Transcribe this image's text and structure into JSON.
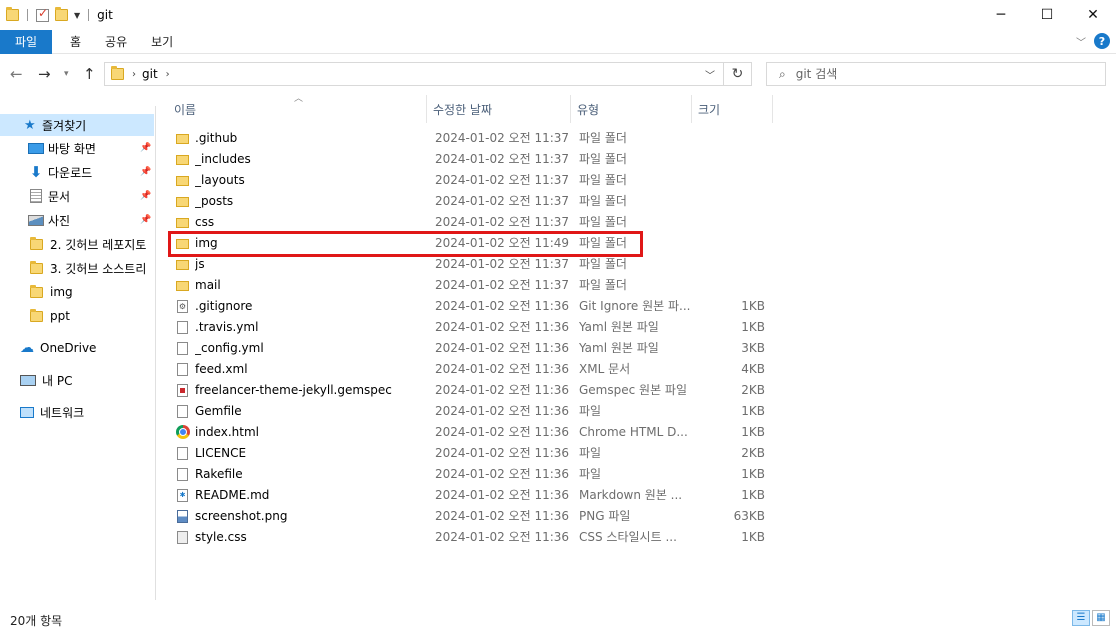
{
  "window": {
    "title": "git",
    "minimize": "─",
    "maximize": "☐",
    "close": "✕"
  },
  "ribbon": {
    "tabs": [
      "파일",
      "홈",
      "공유",
      "보기"
    ],
    "help": "?"
  },
  "address": {
    "path": "git",
    "search_placeholder": "git 검색"
  },
  "sidebar": {
    "quick_access": "즐겨찾기",
    "items": [
      {
        "label": "바탕 화면",
        "icon": "desktop-icon",
        "pinned": true
      },
      {
        "label": "다운로드",
        "icon": "download-icon",
        "pinned": true
      },
      {
        "label": "문서",
        "icon": "document-icon",
        "pinned": true
      },
      {
        "label": "사진",
        "icon": "pictures-icon",
        "pinned": true
      },
      {
        "label": "2. 깃허브 레포지토",
        "icon": "folder-icon",
        "pinned": false
      },
      {
        "label": "3. 깃허브 소스트리",
        "icon": "folder-icon",
        "pinned": false
      },
      {
        "label": "img",
        "icon": "folder-icon",
        "pinned": false
      },
      {
        "label": "ppt",
        "icon": "folder-icon",
        "pinned": false
      }
    ],
    "onedrive": "OneDrive",
    "this_pc": "내 PC",
    "network": "네트워크"
  },
  "columns": {
    "name": "이름",
    "date": "수정한 날짜",
    "type": "유형",
    "size": "크기"
  },
  "files": [
    {
      "name": ".github",
      "date": "2024-01-02 오전 11:37",
      "type": "파일 폴더",
      "size": "",
      "icon": "folder"
    },
    {
      "name": "_includes",
      "date": "2024-01-02 오전 11:37",
      "type": "파일 폴더",
      "size": "",
      "icon": "folder"
    },
    {
      "name": "_layouts",
      "date": "2024-01-02 오전 11:37",
      "type": "파일 폴더",
      "size": "",
      "icon": "folder"
    },
    {
      "name": "_posts",
      "date": "2024-01-02 오전 11:37",
      "type": "파일 폴더",
      "size": "",
      "icon": "folder"
    },
    {
      "name": "css",
      "date": "2024-01-02 오전 11:37",
      "type": "파일 폴더",
      "size": "",
      "icon": "folder"
    },
    {
      "name": "img",
      "date": "2024-01-02 오전 11:49",
      "type": "파일 폴더",
      "size": "",
      "icon": "folder"
    },
    {
      "name": "js",
      "date": "2024-01-02 오전 11:37",
      "type": "파일 폴더",
      "size": "",
      "icon": "folder"
    },
    {
      "name": "mail",
      "date": "2024-01-02 오전 11:37",
      "type": "파일 폴더",
      "size": "",
      "icon": "folder"
    },
    {
      "name": ".gitignore",
      "date": "2024-01-02 오전 11:36",
      "type": "Git Ignore 원본 파...",
      "size": "1KB",
      "icon": "gear"
    },
    {
      "name": ".travis.yml",
      "date": "2024-01-02 오전 11:36",
      "type": "Yaml 원본 파일",
      "size": "1KB",
      "icon": "file"
    },
    {
      "name": "_config.yml",
      "date": "2024-01-02 오전 11:36",
      "type": "Yaml 원본 파일",
      "size": "3KB",
      "icon": "file"
    },
    {
      "name": "feed.xml",
      "date": "2024-01-02 오전 11:36",
      "type": "XML 문서",
      "size": "4KB",
      "icon": "file"
    },
    {
      "name": "freelancer-theme-jekyll.gemspec",
      "date": "2024-01-02 오전 11:36",
      "type": "Gemspec 원본 파일",
      "size": "2KB",
      "icon": "gem"
    },
    {
      "name": "Gemfile",
      "date": "2024-01-02 오전 11:36",
      "type": "파일",
      "size": "1KB",
      "icon": "file"
    },
    {
      "name": "index.html",
      "date": "2024-01-02 오전 11:36",
      "type": "Chrome HTML D...",
      "size": "1KB",
      "icon": "chrome"
    },
    {
      "name": "LICENCE",
      "date": "2024-01-02 오전 11:36",
      "type": "파일",
      "size": "2KB",
      "icon": "file"
    },
    {
      "name": "Rakefile",
      "date": "2024-01-02 오전 11:36",
      "type": "파일",
      "size": "1KB",
      "icon": "file"
    },
    {
      "name": "README.md",
      "date": "2024-01-02 오전 11:36",
      "type": "Markdown 원본 ...",
      "size": "1KB",
      "icon": "md"
    },
    {
      "name": "screenshot.png",
      "date": "2024-01-02 오전 11:36",
      "type": "PNG 파일",
      "size": "63KB",
      "icon": "img"
    },
    {
      "name": "style.css",
      "date": "2024-01-02 오전 11:36",
      "type": "CSS 스타일시트 ...",
      "size": "1KB",
      "icon": "css"
    }
  ],
  "status": {
    "count": "20개 항목"
  },
  "colors": {
    "accent": "#1979ca",
    "selection": "#cce8ff",
    "highlight_box": "#e01717"
  }
}
